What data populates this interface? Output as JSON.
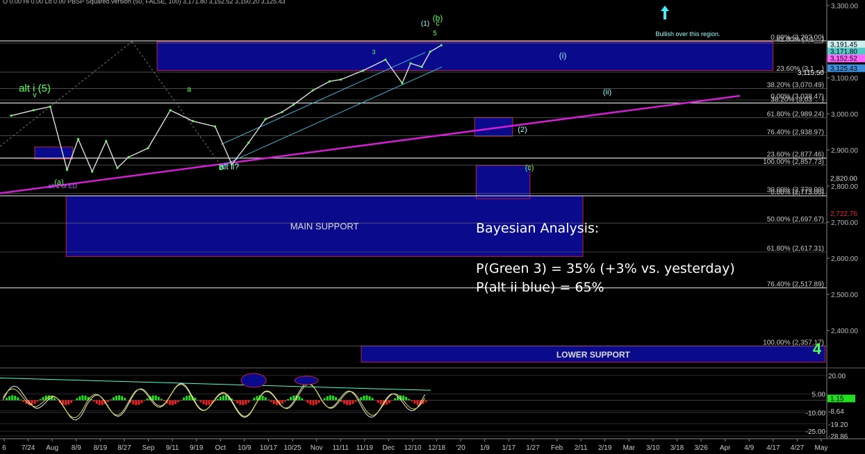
{
  "chart_data": {
    "type": "line",
    "title": "",
    "header_text": [
      "O 0.00",
      "Hi 0.00",
      "Lo 0.00",
      "PBSP Squared.version (50, FALSE, 100)",
      "3,171.80",
      "3,152.52",
      "3,150.20",
      "3,125.43"
    ],
    "series": [
      {
        "name": "",
        "x": [
          "2019-07-16",
          "2019-07-24",
          "2019-07-30",
          "2019-08-05",
          "2019-08-09",
          "2019-08-14",
          "2019-08-19",
          "2019-08-23",
          "2019-08-27",
          "2019-09-03",
          "2019-09-11",
          "2019-09-19",
          "2019-09-27",
          "2019-10-03",
          "2019-10-09",
          "2019-10-15",
          "2019-10-21",
          "2019-10-25",
          "2019-11-01",
          "2019-11-07",
          "2019-11-11",
          "2019-11-19",
          "2019-11-27",
          "2019-12-03",
          "2019-12-06",
          "2019-12-10",
          "2019-12-13",
          "2019-12-17"
        ],
        "values": [
          2995,
          3010,
          3020,
          2845,
          2930,
          2840,
          2925,
          2850,
          2880,
          2905,
          3010,
          2980,
          2965,
          2860,
          2920,
          2985,
          3005,
          3025,
          3065,
          3090,
          3095,
          3120,
          3150,
          3085,
          3140,
          3130,
          3172,
          3190
        ]
      }
    ],
    "x_axis": {
      "tick_labels": [
        "6",
        "7/24",
        "Aug",
        "8/9",
        "8/19",
        "8/27",
        "Sep",
        "9/11",
        "9/19",
        "Oct",
        "10/9",
        "10/17",
        "10/25",
        "Nov",
        "11/11",
        "11/19",
        "Dec",
        "12/10",
        "12/18",
        "'20",
        "1/9",
        "1/17",
        "1/27",
        "Feb",
        "2/11",
        "2/19",
        "Mar",
        "3/10",
        "3/18",
        "3/26",
        "Apr",
        "4/9",
        "4/17",
        "4/27",
        "May"
      ]
    },
    "y_axis": {
      "ylim": [
        2300,
        3300
      ],
      "tick_labels": [
        "3,300.00",
        "3,100.00",
        "3,000.00",
        "2,900.00",
        "2,800.00",
        "2,700.00",
        "2,600.00",
        "2,500.00",
        "2,400.00"
      ]
    },
    "price_labels": [
      {
        "text": "3,191.45",
        "value": 3191.45,
        "color": "#cfeeee"
      },
      {
        "text": "3,171.80",
        "value": 3171.8,
        "color": "#56c8c8"
      },
      {
        "text": "3,152.52",
        "value": 3152.52,
        "color": "#ff66ff"
      },
      {
        "text": "3,125.43",
        "value": 3125.43,
        "color": "#3b8fd8"
      },
      {
        "text": "2,820.00",
        "value": 2820,
        "color": "#000000"
      },
      {
        "text": "2,722.76",
        "value": 2722.76,
        "color": "#000000"
      }
    ],
    "fib_levels": [
      {
        "text": "0.00% (3,202.00)",
        "value": 3202
      },
      {
        "text": "61.80% (3,1__)",
        "value": 3196
      },
      {
        "text": "23.60% (3,1__)",
        "value": 3115.5
      },
      {
        "text": "3,115.50",
        "value": 3115.5
      },
      {
        "text": "38.20% (3,070.49)",
        "value": 3070.49
      },
      {
        "text": "0.00% (3,038.47)",
        "value": 3038.47
      },
      {
        "text": "38.20% (3,03_._)",
        "value": 3030
      },
      {
        "text": "61.80% (2,989.24)",
        "value": 2989.24
      },
      {
        "text": "76.40% (2,938.97)",
        "value": 2938.97
      },
      {
        "text": "23.60% (2,877.46)",
        "value": 2877.46
      },
      {
        "text": "100.00% (2,857.73)",
        "value": 2857.73
      },
      {
        "text": "30.00% (2,779.00)",
        "value": 2780
      },
      {
        "text": "0.00% (2,773.00)",
        "value": 2773
      },
      {
        "text": "50.00% (2,697.67)",
        "value": 2697.67
      },
      {
        "text": "61.80% (2,617.31)",
        "value": 2617.31
      },
      {
        "text": "76.40% (2,517.89)",
        "value": 2517.89
      },
      {
        "text": "100.00% (2,357.17)",
        "value": 2357.17
      }
    ],
    "zones": [
      {
        "label": "",
        "x": [
          0.19,
          0.935
        ],
        "y": [
          3120,
          3200
        ]
      },
      {
        "label": "MAIN SUPPORT",
        "x": [
          0.08,
          0.705
        ],
        "y": [
          2605,
          2773
        ]
      },
      {
        "label": "LOWER SUPPORT",
        "x": [
          0.437,
          0.998
        ],
        "y": [
          2312,
          2357
        ]
      },
      {
        "label": "",
        "x": [
          0.576,
          0.641
        ],
        "y": [
          2765,
          2857
        ]
      },
      {
        "label": "",
        "x": [
          0.574,
          0.62
        ],
        "y": [
          2938,
          2990
        ]
      },
      {
        "label": "",
        "x": [
          0.042,
          0.088
        ],
        "y": [
          2875,
          2908
        ]
      }
    ],
    "annotations": [
      {
        "text": "Bullish over this region.",
        "color": "#9ff"
      },
      {
        "text": "(1)",
        "color": "#9ff"
      },
      {
        "text": "c",
        "color": "#5f5"
      },
      {
        "text": "(b)",
        "color": "#5f5"
      },
      {
        "text": "5",
        "color": "#5f5"
      },
      {
        "text": "3",
        "color": "#5f5"
      },
      {
        "text": "alt i (5)",
        "color": "#5f5"
      },
      {
        "text": "v",
        "color": "#5f5"
      },
      {
        "text": "a",
        "color": "#5f5"
      },
      {
        "text": "b",
        "color": "#5f5"
      },
      {
        "text": "alt ii?",
        "color": "#9ff"
      },
      {
        "text": "(a)",
        "color": "#5f5"
      },
      {
        "text": "alt 2 of ED",
        "color": "#c6f"
      },
      {
        "text": "(i)",
        "color": "#9ff"
      },
      {
        "text": "(ii)",
        "color": "#9ff"
      },
      {
        "text": "(2)",
        "color": "#9ff"
      },
      {
        "text": "(c)",
        "color": "#5f5"
      },
      {
        "text": "4",
        "color": "#5f5"
      }
    ],
    "analysis": {
      "heading": "Bayesian Analysis:",
      "line1": "P(Green 3) = 35% (+3% vs. yesterday)",
      "line2": "P(alt ii blue) = 65%"
    },
    "oscillator": {
      "tick_labels": [
        "20.00",
        "5.00",
        "-8.64",
        "-10.00",
        "-19.20",
        "-25.00",
        "-28.86"
      ],
      "current_value": "1.15",
      "ylim": [
        -30,
        25
      ]
    },
    "colors": {
      "zone_fill": "#0a0a8c",
      "zone_border": "#c02040",
      "price": "#e0e0e0",
      "trend_magenta": "#d020d0",
      "channel": "#40b8d8",
      "green_label": "#5f5",
      "osc_pos": "#22dd22",
      "osc_neg": "#ee2222"
    }
  }
}
